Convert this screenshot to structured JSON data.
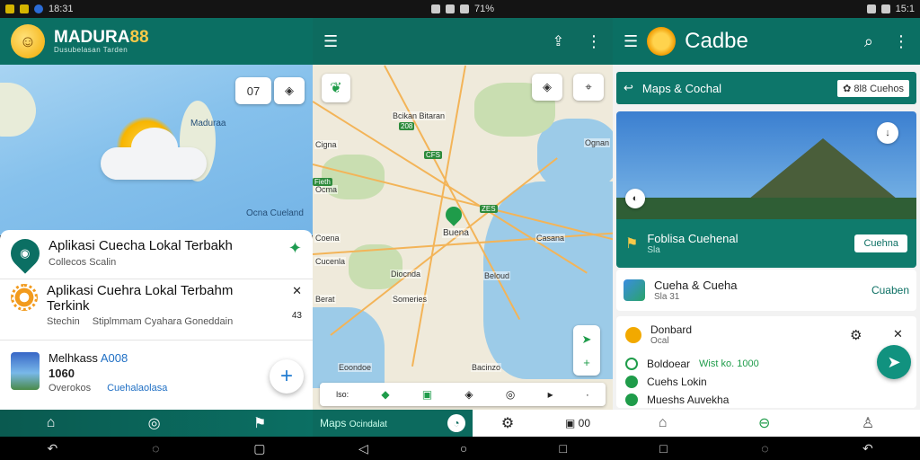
{
  "screen1": {
    "status": {
      "time": "18:31"
    },
    "app": {
      "title": "MADURA",
      "title_accent": "88",
      "subtitle": "Dusubelasan Tarden"
    },
    "map": {
      "chip_value": "07",
      "label": "Maduraa",
      "label2": "Ocna Cueland"
    },
    "items": [
      {
        "title": "Aplikasi Cuecha Lokal Terbakh",
        "subtitle": "Collecos Scalin"
      },
      {
        "title": "Aplikasi Cuehra Lokal Terbahm Terkink",
        "subtitle": "Stechin",
        "detail": "Stiplmmam Cyahara Goneddain",
        "meta": "43"
      },
      {
        "title": "Melhkass",
        "title_accent": "A008",
        "value": "1060",
        "meta_left": "Overokos",
        "link": "Cuehalaolasa"
      }
    ],
    "icons": {
      "home": "home-icon",
      "compass": "compass-icon",
      "flag": "flag-icon"
    }
  },
  "screen2": {
    "status": {
      "battery": "71%"
    },
    "map_labels": [
      "Bcikan Bitaran",
      "Cigna",
      "Ocma",
      "Ognan",
      "Coena",
      "Buena",
      "Casana",
      "Cucenla",
      "Beloud",
      "Diocnda",
      "Someries",
      "Eoondoe",
      "Bacinzo",
      "Berat"
    ],
    "badges": [
      "208",
      "CFS",
      "ZES",
      "Fieth"
    ],
    "toolbar_left": "lso:",
    "tab_label": "Maps",
    "tab_sub": "Ocindalat",
    "tab_right": "00"
  },
  "screen3": {
    "status": {
      "time": "15:1"
    },
    "app": {
      "title": "Cadbe"
    },
    "banner": {
      "label": "Maps & Cochal",
      "right": "8l8 Cuehos"
    },
    "hero": {
      "title": "Foblisa Cuehenal",
      "sub": "Sla",
      "button": "Cuehna"
    },
    "row": {
      "title": "Cueha & Cueha",
      "sub": "Sla",
      "sub2": "31",
      "link": "Cuaben"
    },
    "list": [
      {
        "title": "Donbard",
        "sub": "Ocal"
      },
      {
        "title": "Boldoear",
        "accent": "Wist ko. 1000",
        "color": "green"
      },
      {
        "title": "Cuehs Lokin"
      },
      {
        "title": "Mueshs Auvekha"
      }
    ]
  }
}
